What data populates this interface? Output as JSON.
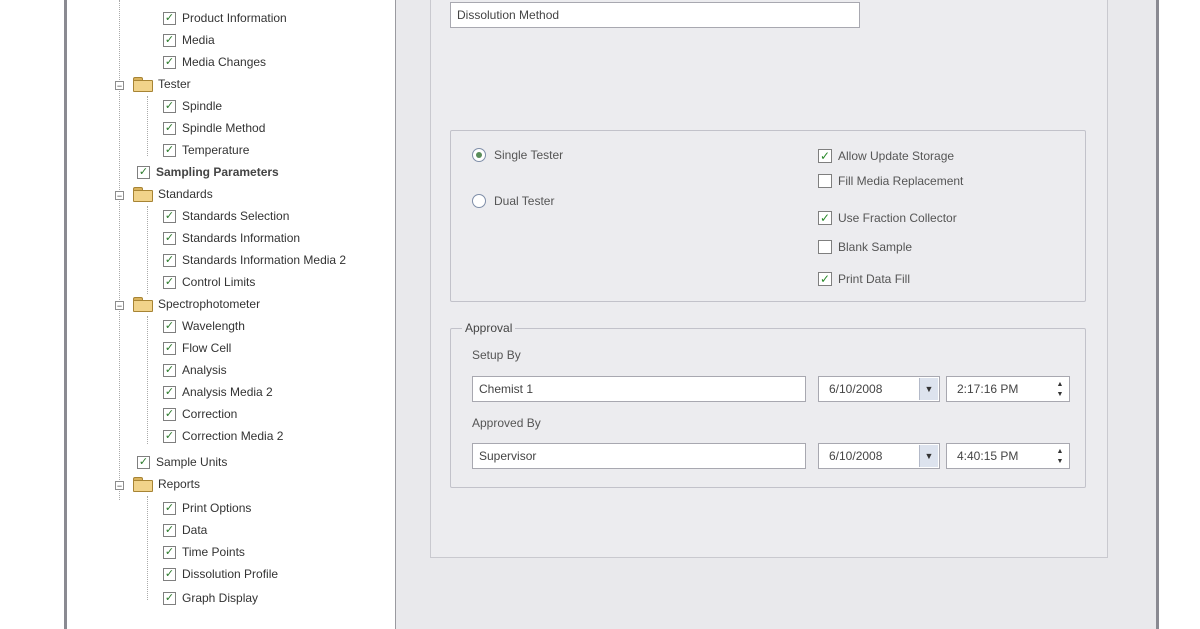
{
  "tree": {
    "items": [
      {
        "label": "Product Information",
        "checked": true
      },
      {
        "label": "Media",
        "checked": true
      },
      {
        "label": "Media Changes",
        "checked": true
      },
      {
        "label": "Tester",
        "folder": true
      },
      {
        "label": "Spindle",
        "checked": true
      },
      {
        "label": "Spindle Method",
        "checked": true
      },
      {
        "label": "Temperature",
        "checked": true
      },
      {
        "label": "Sampling Parameters",
        "checked": true
      },
      {
        "label": "Standards",
        "folder": true
      },
      {
        "label": "Standards Selection",
        "checked": true
      },
      {
        "label": "Standards Information",
        "checked": true
      },
      {
        "label": "Standards Information Media 2",
        "checked": true
      },
      {
        "label": "Control Limits",
        "checked": true
      },
      {
        "label": "Spectrophotometer",
        "folder": true
      },
      {
        "label": "Wavelength",
        "checked": true
      },
      {
        "label": "Flow Cell",
        "checked": true
      },
      {
        "label": "Analysis",
        "checked": true
      },
      {
        "label": "Analysis Media 2",
        "checked": true
      },
      {
        "label": "Correction",
        "checked": true
      },
      {
        "label": "Correction Media 2",
        "checked": true
      },
      {
        "label": "Sample Units",
        "checked": true
      },
      {
        "label": "Reports",
        "folder": true
      },
      {
        "label": "Print Options",
        "checked": true
      },
      {
        "label": "Data",
        "checked": true
      },
      {
        "label": "Time Points",
        "checked": true
      },
      {
        "label": "Dissolution Profile",
        "checked": true
      },
      {
        "label": "Graph Display",
        "checked": true
      }
    ]
  },
  "method_name": {
    "value": "Dissolution Method"
  },
  "options": {
    "single_tester": "Single Tester",
    "dual_tester": "Dual Tester",
    "single_tester_selected": true,
    "allow_update_storage": "Allow Update Storage",
    "fill_media_replacement": "Fill Media Replacement",
    "use_fraction_collector": "Use Fraction Collector",
    "blank_sample": "Blank Sample",
    "print_data_fill": "Print Data Fill",
    "allow_update_storage_checked": true,
    "fill_media_replacement_checked": false,
    "use_fraction_collector_checked": true,
    "blank_sample_checked": false,
    "print_data_fill_checked": true
  },
  "approval": {
    "title": "Approval",
    "setup_by_label": "Setup By",
    "setup_by_value": "Chemist 1",
    "setup_date": "6/10/2008",
    "setup_time": "2:17:16 PM",
    "approved_by_label": "Approved By",
    "approved_by_value": "Supervisor",
    "approved_date": "6/10/2008",
    "approved_time": "4:40:15 PM"
  },
  "icons": {
    "folder": "folder-icon",
    "checkbox": "checkbox-icon",
    "dropdown": "chevron-down-icon",
    "spin": "spin-updown-icon"
  }
}
